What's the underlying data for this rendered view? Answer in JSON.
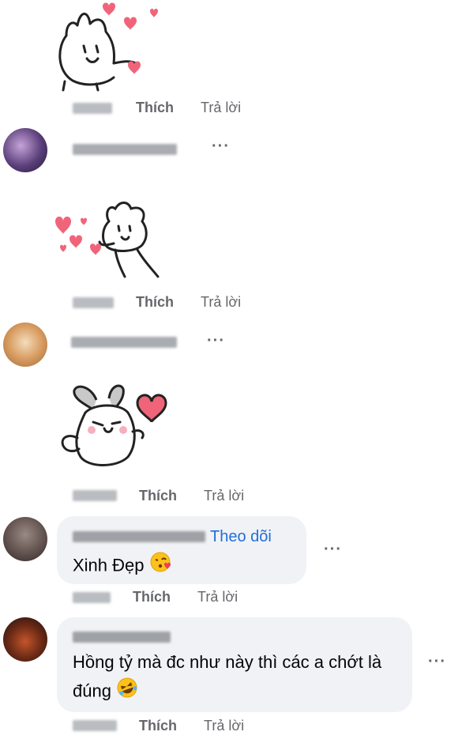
{
  "actions": {
    "like": "Thích",
    "reply": "Trả lời"
  },
  "comments": [
    {
      "text": ""
    },
    {
      "text": ""
    },
    {
      "text": ""
    },
    {
      "follow": "Theo dõi",
      "text": "Xinh Đẹp"
    },
    {
      "text": "Hồng tỷ mà đc như này thì các a chớt là đúng"
    }
  ],
  "more": "···",
  "icons": [
    "sticker-bunny-hearts",
    "sticker-bunny-dance",
    "sticker-bunny-heart",
    "blow-kiss-emoji",
    "laughing-emoji",
    "more-options-icon"
  ],
  "colors": {
    "bubble": "#f0f2f5",
    "link": "#216fdb",
    "meta": "#65676b",
    "heart": "#f0647a"
  }
}
